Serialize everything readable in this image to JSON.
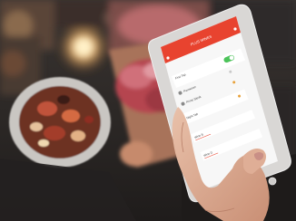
{
  "phone_app": {
    "header": {
      "title": "PLUS WINES"
    },
    "rows": [
      {
        "label": "First Tap"
      },
      {
        "label": "Parmesan"
      },
      {
        "label": "Prime Steak"
      },
      {
        "label": "Night Tab"
      },
      {
        "label": "Wine B"
      },
      {
        "label": "Wine D"
      }
    ]
  },
  "colors": {
    "app_header_red": "#e8432f",
    "toggle_green": "#4cc35a",
    "plate_rim": "#c9c6c2",
    "board_wood": "#a8735a",
    "phone_frame": "#d9d7d5"
  }
}
